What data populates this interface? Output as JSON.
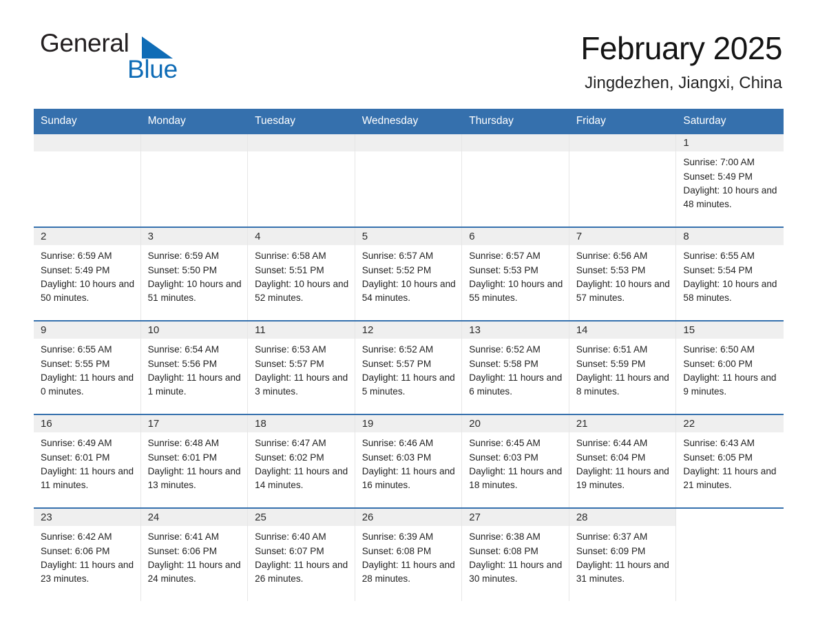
{
  "brand": {
    "name_part1": "General",
    "name_part2": "Blue",
    "triangle_color": "#0f6cb6"
  },
  "header": {
    "month_title": "February 2025",
    "location": "Jingdezhen, Jiangxi, China"
  },
  "colors": {
    "header_blue": "#3570ad",
    "day_band_gray": "#efefef",
    "rule_blue": "#3570ad"
  },
  "weekdays": [
    "Sunday",
    "Monday",
    "Tuesday",
    "Wednesday",
    "Thursday",
    "Friday",
    "Saturday"
  ],
  "weeks": [
    [
      {
        "day": "",
        "empty": true
      },
      {
        "day": "",
        "empty": true
      },
      {
        "day": "",
        "empty": true
      },
      {
        "day": "",
        "empty": true
      },
      {
        "day": "",
        "empty": true
      },
      {
        "day": "",
        "empty": true
      },
      {
        "day": "1",
        "sunrise": "Sunrise: 7:00 AM",
        "sunset": "Sunset: 5:49 PM",
        "daylight": "Daylight: 10 hours and 48 minutes."
      }
    ],
    [
      {
        "day": "2",
        "sunrise": "Sunrise: 6:59 AM",
        "sunset": "Sunset: 5:49 PM",
        "daylight": "Daylight: 10 hours and 50 minutes."
      },
      {
        "day": "3",
        "sunrise": "Sunrise: 6:59 AM",
        "sunset": "Sunset: 5:50 PM",
        "daylight": "Daylight: 10 hours and 51 minutes."
      },
      {
        "day": "4",
        "sunrise": "Sunrise: 6:58 AM",
        "sunset": "Sunset: 5:51 PM",
        "daylight": "Daylight: 10 hours and 52 minutes."
      },
      {
        "day": "5",
        "sunrise": "Sunrise: 6:57 AM",
        "sunset": "Sunset: 5:52 PM",
        "daylight": "Daylight: 10 hours and 54 minutes."
      },
      {
        "day": "6",
        "sunrise": "Sunrise: 6:57 AM",
        "sunset": "Sunset: 5:53 PM",
        "daylight": "Daylight: 10 hours and 55 minutes."
      },
      {
        "day": "7",
        "sunrise": "Sunrise: 6:56 AM",
        "sunset": "Sunset: 5:53 PM",
        "daylight": "Daylight: 10 hours and 57 minutes."
      },
      {
        "day": "8",
        "sunrise": "Sunrise: 6:55 AM",
        "sunset": "Sunset: 5:54 PM",
        "daylight": "Daylight: 10 hours and 58 minutes."
      }
    ],
    [
      {
        "day": "9",
        "sunrise": "Sunrise: 6:55 AM",
        "sunset": "Sunset: 5:55 PM",
        "daylight": "Daylight: 11 hours and 0 minutes."
      },
      {
        "day": "10",
        "sunrise": "Sunrise: 6:54 AM",
        "sunset": "Sunset: 5:56 PM",
        "daylight": "Daylight: 11 hours and 1 minute."
      },
      {
        "day": "11",
        "sunrise": "Sunrise: 6:53 AM",
        "sunset": "Sunset: 5:57 PM",
        "daylight": "Daylight: 11 hours and 3 minutes."
      },
      {
        "day": "12",
        "sunrise": "Sunrise: 6:52 AM",
        "sunset": "Sunset: 5:57 PM",
        "daylight": "Daylight: 11 hours and 5 minutes."
      },
      {
        "day": "13",
        "sunrise": "Sunrise: 6:52 AM",
        "sunset": "Sunset: 5:58 PM",
        "daylight": "Daylight: 11 hours and 6 minutes."
      },
      {
        "day": "14",
        "sunrise": "Sunrise: 6:51 AM",
        "sunset": "Sunset: 5:59 PM",
        "daylight": "Daylight: 11 hours and 8 minutes."
      },
      {
        "day": "15",
        "sunrise": "Sunrise: 6:50 AM",
        "sunset": "Sunset: 6:00 PM",
        "daylight": "Daylight: 11 hours and 9 minutes."
      }
    ],
    [
      {
        "day": "16",
        "sunrise": "Sunrise: 6:49 AM",
        "sunset": "Sunset: 6:01 PM",
        "daylight": "Daylight: 11 hours and 11 minutes."
      },
      {
        "day": "17",
        "sunrise": "Sunrise: 6:48 AM",
        "sunset": "Sunset: 6:01 PM",
        "daylight": "Daylight: 11 hours and 13 minutes."
      },
      {
        "day": "18",
        "sunrise": "Sunrise: 6:47 AM",
        "sunset": "Sunset: 6:02 PM",
        "daylight": "Daylight: 11 hours and 14 minutes."
      },
      {
        "day": "19",
        "sunrise": "Sunrise: 6:46 AM",
        "sunset": "Sunset: 6:03 PM",
        "daylight": "Daylight: 11 hours and 16 minutes."
      },
      {
        "day": "20",
        "sunrise": "Sunrise: 6:45 AM",
        "sunset": "Sunset: 6:03 PM",
        "daylight": "Daylight: 11 hours and 18 minutes."
      },
      {
        "day": "21",
        "sunrise": "Sunrise: 6:44 AM",
        "sunset": "Sunset: 6:04 PM",
        "daylight": "Daylight: 11 hours and 19 minutes."
      },
      {
        "day": "22",
        "sunrise": "Sunrise: 6:43 AM",
        "sunset": "Sunset: 6:05 PM",
        "daylight": "Daylight: 11 hours and 21 minutes."
      }
    ],
    [
      {
        "day": "23",
        "sunrise": "Sunrise: 6:42 AM",
        "sunset": "Sunset: 6:06 PM",
        "daylight": "Daylight: 11 hours and 23 minutes."
      },
      {
        "day": "24",
        "sunrise": "Sunrise: 6:41 AM",
        "sunset": "Sunset: 6:06 PM",
        "daylight": "Daylight: 11 hours and 24 minutes."
      },
      {
        "day": "25",
        "sunrise": "Sunrise: 6:40 AM",
        "sunset": "Sunset: 6:07 PM",
        "daylight": "Daylight: 11 hours and 26 minutes."
      },
      {
        "day": "26",
        "sunrise": "Sunrise: 6:39 AM",
        "sunset": "Sunset: 6:08 PM",
        "daylight": "Daylight: 11 hours and 28 minutes."
      },
      {
        "day": "27",
        "sunrise": "Sunrise: 6:38 AM",
        "sunset": "Sunset: 6:08 PM",
        "daylight": "Daylight: 11 hours and 30 minutes."
      },
      {
        "day": "28",
        "sunrise": "Sunrise: 6:37 AM",
        "sunset": "Sunset: 6:09 PM",
        "daylight": "Daylight: 11 hours and 31 minutes."
      },
      {
        "day": "",
        "empty": true,
        "no_band": true
      }
    ]
  ]
}
